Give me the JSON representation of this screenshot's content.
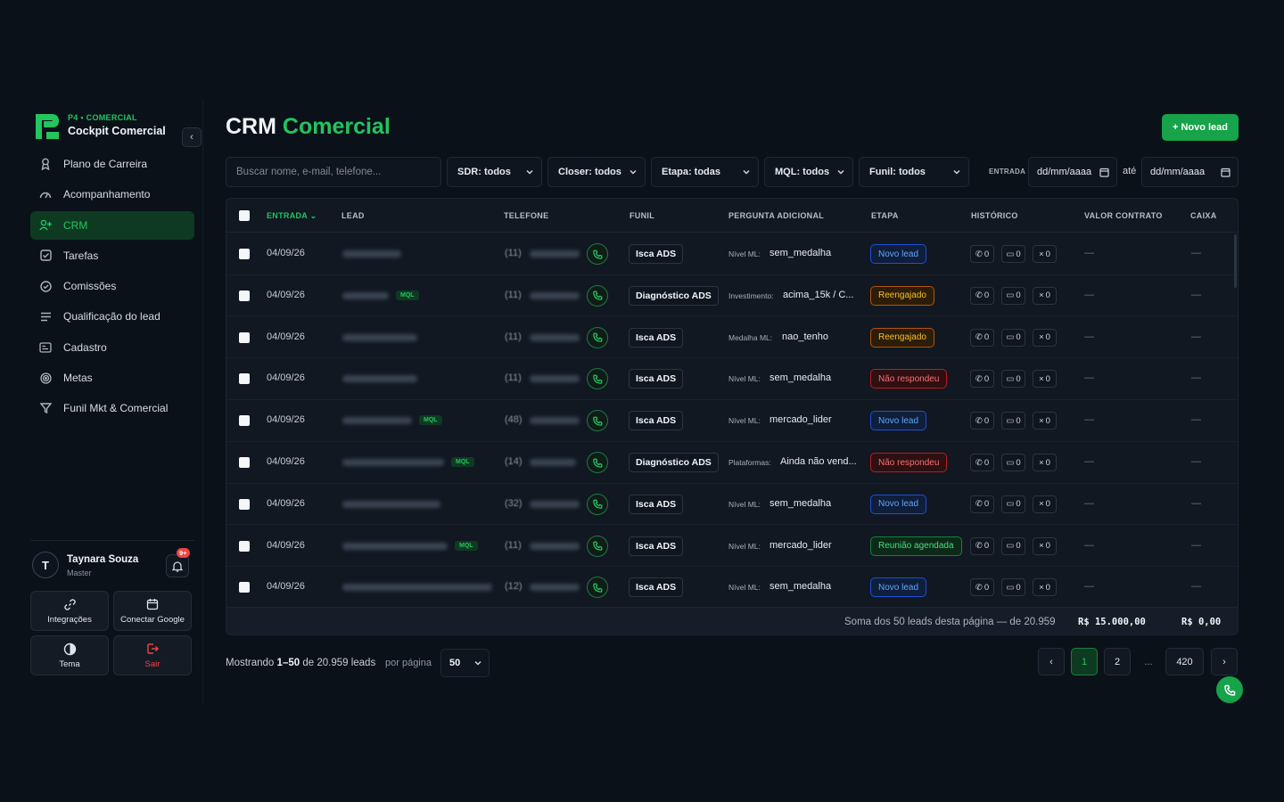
{
  "brand": {
    "subtitle": "P4 • COMERCIAL",
    "name": "Cockpit Comercial",
    "accent_color": "#22c55e"
  },
  "nav": [
    {
      "label": "Plano de Carreira",
      "icon": "ribbon-icon"
    },
    {
      "label": "Acompanhamento",
      "icon": "gauge-icon"
    },
    {
      "label": "CRM",
      "icon": "user-plus-icon",
      "active": true
    },
    {
      "label": "Tarefas",
      "icon": "checkbox-icon"
    },
    {
      "label": "Comissões",
      "icon": "check-circle-icon"
    },
    {
      "label": "Qualificação do lead",
      "icon": "list-icon"
    },
    {
      "label": "Cadastro",
      "icon": "id-card-icon"
    },
    {
      "label": "Metas",
      "icon": "target-icon"
    },
    {
      "label": "Funil Mkt & Comercial",
      "icon": "funnel-icon"
    }
  ],
  "user": {
    "initial": "T",
    "name": "Taynara Souza",
    "role": "Master",
    "notifications": "9+"
  },
  "tools": {
    "integrations": "Integrações",
    "google": "Conectar Google",
    "theme": "Tema",
    "logout": "Sair"
  },
  "page": {
    "title_a": "CRM",
    "title_b": "Comercial",
    "new_lead": "+ Novo lead"
  },
  "filters": {
    "search_placeholder": "Buscar nome, e-mail, telefone...",
    "sdr": "SDR: todos",
    "closer": "Closer: todos",
    "etapa": "Etapa: todas",
    "mql": "MQL: todos",
    "funil": "Funil: todos",
    "entrada_label": "ENTRADA",
    "date_from": "dd/mm/aaaa",
    "ate": "até",
    "date_to": "dd/mm/aaaa"
  },
  "columns": {
    "entrada": "ENTRADA",
    "lead": "LEAD",
    "telefone": "TELEFONE",
    "funil": "FUNIL",
    "pergunta": "PERGUNTA ADICIONAL",
    "etapa": "ETAPA",
    "historico": "HISTÓRICO",
    "valor": "VALOR CONTRATO",
    "caixa": "CAIXA"
  },
  "rows": [
    {
      "date": "04/09/26",
      "mql": "",
      "ddd": "(11)",
      "funil": "Isca ADS",
      "q_key": "Nível ML:",
      "q_val": "sem_medalha",
      "stage": "Novo lead",
      "stage_type": "novo",
      "calls": "0",
      "msgs": "0",
      "misses": "0",
      "valor": "—",
      "caixa": "—"
    },
    {
      "date": "04/09/26",
      "mql": "MQL",
      "ddd": "(11)",
      "funil": "Diagnóstico ADS",
      "q_key": "Investimento:",
      "q_val": "acima_15k / C...",
      "stage": "Reengajado",
      "stage_type": "reeng",
      "calls": "0",
      "msgs": "0",
      "misses": "0",
      "valor": "—",
      "caixa": "—"
    },
    {
      "date": "04/09/26",
      "mql": "",
      "ddd": "(11)",
      "funil": "Isca ADS",
      "q_key": "Medalha ML:",
      "q_val": "nao_tenho",
      "stage": "Reengajado",
      "stage_type": "reeng",
      "calls": "0",
      "msgs": "0",
      "misses": "0",
      "valor": "—",
      "caixa": "—"
    },
    {
      "date": "04/09/26",
      "mql": "",
      "ddd": "(11)",
      "funil": "Isca ADS",
      "q_key": "Nível ML:",
      "q_val": "sem_medalha",
      "stage": "Não respondeu",
      "stage_type": "naoresp",
      "calls": "0",
      "msgs": "0",
      "misses": "0",
      "valor": "—",
      "caixa": "—"
    },
    {
      "date": "04/09/26",
      "mql": "MQL",
      "ddd": "(48)",
      "funil": "Isca ADS",
      "q_key": "Nível ML:",
      "q_val": "mercado_lider",
      "stage": "Novo lead",
      "stage_type": "novo",
      "calls": "0",
      "msgs": "0",
      "misses": "0",
      "valor": "—",
      "caixa": "—"
    },
    {
      "date": "04/09/26",
      "mql": "MQL",
      "ddd": "(14)",
      "funil": "Diagnóstico ADS",
      "q_key": "Plataformas:",
      "q_val": "Ainda não vend...",
      "stage": "Não respondeu",
      "stage_type": "naoresp",
      "calls": "0",
      "msgs": "0",
      "misses": "0",
      "valor": "—",
      "caixa": "—"
    },
    {
      "date": "04/09/26",
      "mql": "",
      "ddd": "(32)",
      "funil": "Isca ADS",
      "q_key": "Nível ML:",
      "q_val": "sem_medalha",
      "stage": "Novo lead",
      "stage_type": "novo",
      "calls": "0",
      "msgs": "0",
      "misses": "0",
      "valor": "—",
      "caixa": "—"
    },
    {
      "date": "04/09/26",
      "mql": "MQL",
      "ddd": "(11)",
      "funil": "Isca ADS",
      "q_key": "Nível ML:",
      "q_val": "mercado_lider",
      "stage": "Reunião agendada",
      "stage_type": "reuniao",
      "calls": "0",
      "msgs": "0",
      "misses": "0",
      "valor": "—",
      "caixa": "—"
    },
    {
      "date": "04/09/26",
      "mql": "",
      "ddd": "(12)",
      "funil": "Isca ADS",
      "q_key": "Nível ML:",
      "q_val": "sem_medalha",
      "stage": "Novo lead",
      "stage_type": "novo",
      "calls": "0",
      "msgs": "0",
      "misses": "0",
      "valor": "—",
      "caixa": "—"
    }
  ],
  "footer": {
    "sum_label": "Soma dos 50 leads desta página — de 20.959",
    "sum_valor": "R$ 15.000,00",
    "sum_caixa": "R$ 0,00"
  },
  "pagination": {
    "showing_prefix": "Mostrando",
    "showing_range": "1–50",
    "showing_suffix": "de 20.959 leads",
    "per_page_label": "por página",
    "per_page_value": "50",
    "prev": "‹",
    "pages": [
      "1",
      "2"
    ],
    "ellipsis": "...",
    "last": "420",
    "next": "›"
  }
}
